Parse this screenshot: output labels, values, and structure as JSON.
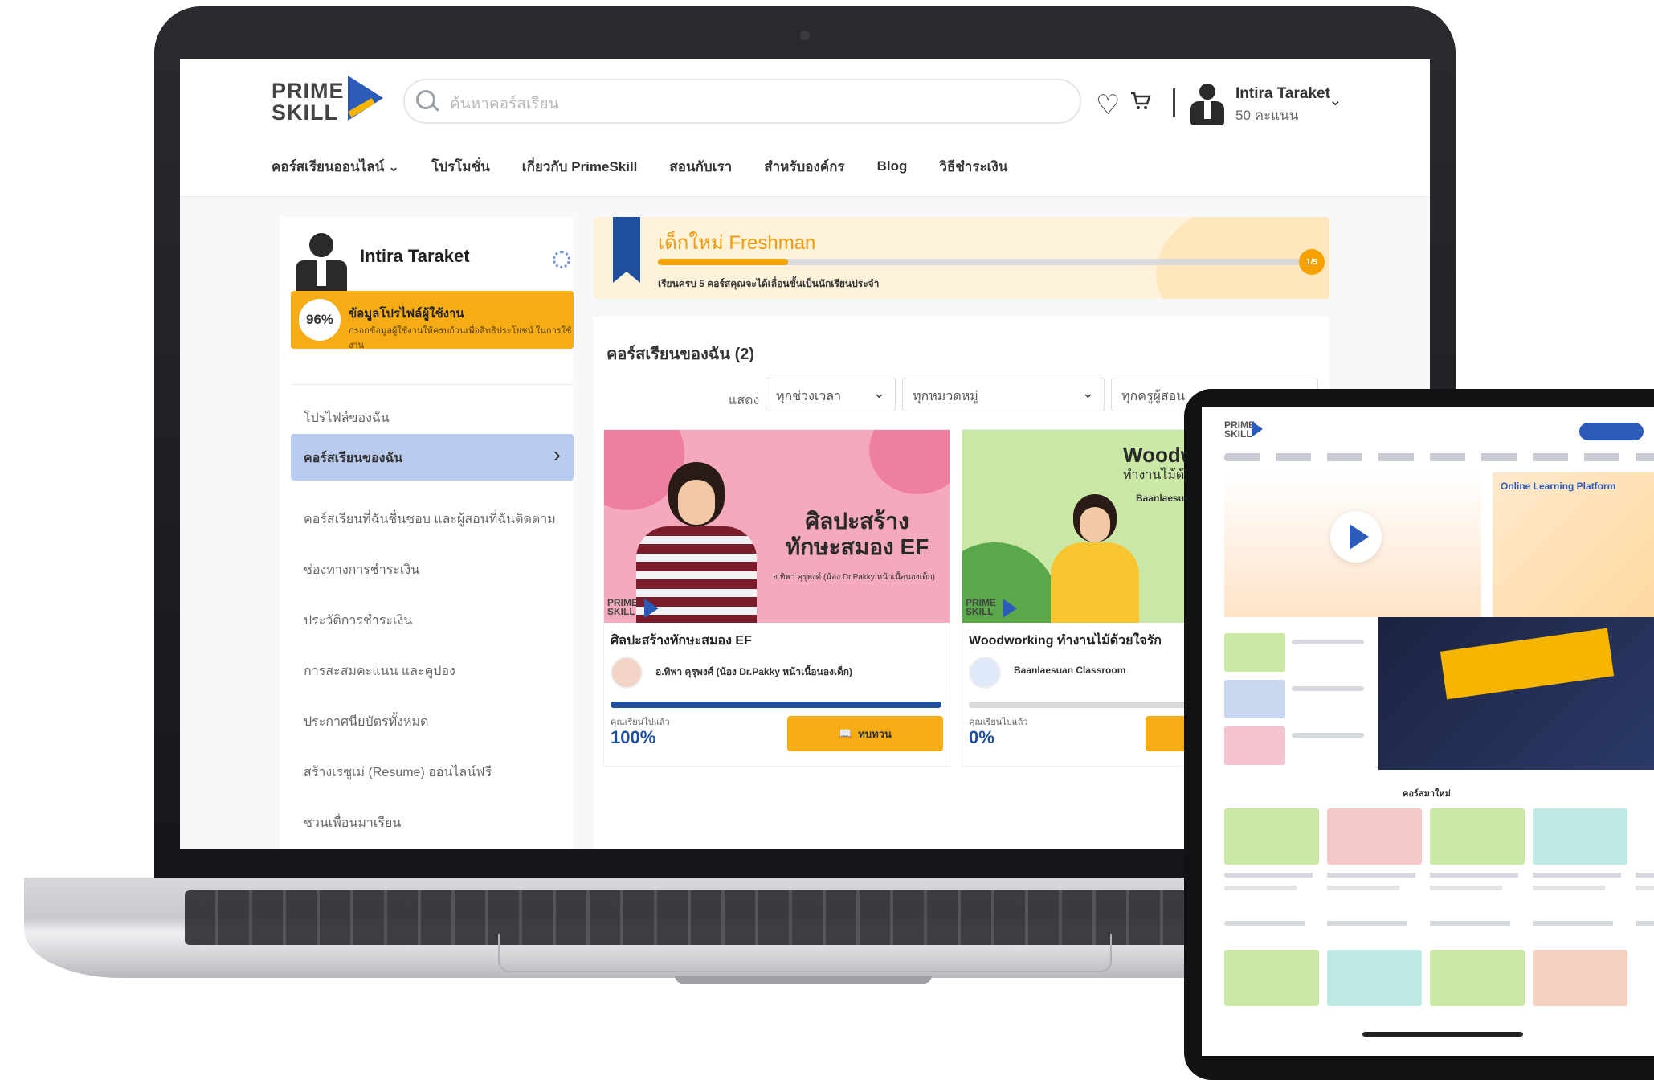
{
  "header": {
    "logo_line1": "PRIME",
    "logo_line2": "SKILL",
    "search_placeholder": "ค้นหาคอร์สเรียน",
    "heart_icon": "♡",
    "cart_icon": "🛒",
    "user_name": "Intira Taraket",
    "user_points": "50 คะแนน",
    "chevron": "⌄"
  },
  "nav": {
    "items": [
      "คอร์สเรียนออนไลน์ ⌄",
      "โปรโมชั่น",
      "เกี่ยวกับ PrimeSkill",
      "สอนกับเรา",
      "สำหรับองค์กร",
      "Blog",
      "วิธีชำระเงิน"
    ]
  },
  "profile": {
    "name": "Intira Taraket",
    "completion": "96%",
    "completion_value": 0.96,
    "completion_title": "ข้อมูลโปรไฟล์ผู้ใช้งาน",
    "completion_sub": "กรอกข้อมูลผู้ใช้งานให้ครบถ้วนเพื่อสิทธิประโยชน์ ในการใช้งาน",
    "menu": [
      "โปรไฟล์ของฉัน",
      "คอร์สเรียนของฉัน",
      "คอร์สเรียนที่ฉันชื่นชอบ และผู้สอนที่ฉันติดตาม",
      "ช่องทางการชำระเงิน",
      "ประวัติการชำระเงิน",
      "การสะสมคะแนน และคูปอง",
      "ประกาศนียบัตรทั้งหมด",
      "สร้างเรซูเม่ (Resume) ออนไลน์ฟรี",
      "ชวนเพื่อนมาเรียน"
    ],
    "active_index": 1
  },
  "rank": {
    "title": "เด็กใหม่ Freshman",
    "progress": 0.2,
    "badge": "1/5",
    "note": "เรียนครบ 5 คอร์สคุณจะได้เลื่อนขั้นเป็นนักเรียนประจำ"
  },
  "my_courses": {
    "title": "คอร์สเรียนของฉัน (2)",
    "show_label": "แสดง",
    "filters": [
      "ทุกช่วงเวลา",
      "ทุกหมวดหมู่",
      "ทุกครูผู้สอน"
    ],
    "progress_label": "คุณเรียนไปแล้ว",
    "courses": [
      {
        "thumb_title_1": "ศิลปะสร้าง",
        "thumb_title_2": "ทักษะสมอง EF",
        "thumb_sub": "อ.ทิพา คุรุพงศ์ (น้อง Dr.Pakky หน้าเนื้อนองเด็ก)",
        "title": "ศิลปะสร้างทักษะสมอง EF",
        "instructor": "อ.ทิพา คุรุพงศ์ (น้อง Dr.Pakky หน้าเนื้อนองเด็ก)",
        "progress_value": 1.0,
        "progress_text": "100%",
        "button": "ทบทวน"
      },
      {
        "thumb_title_1": "Woodwork",
        "thumb_title_2": "ทำงานไม้ด้วยใจ",
        "thumb_sub": "Baanlaesuan Class",
        "title": "Woodworking ทำงานไม้ด้วยใจรัก",
        "instructor": "Baanlaesuan Classroom",
        "progress_value": 0.0,
        "progress_text": "0%",
        "button": ""
      }
    ]
  },
  "tablet": {
    "hero_title": "Online Learning Platform",
    "section_title": "คอร์สมาใหม่"
  }
}
